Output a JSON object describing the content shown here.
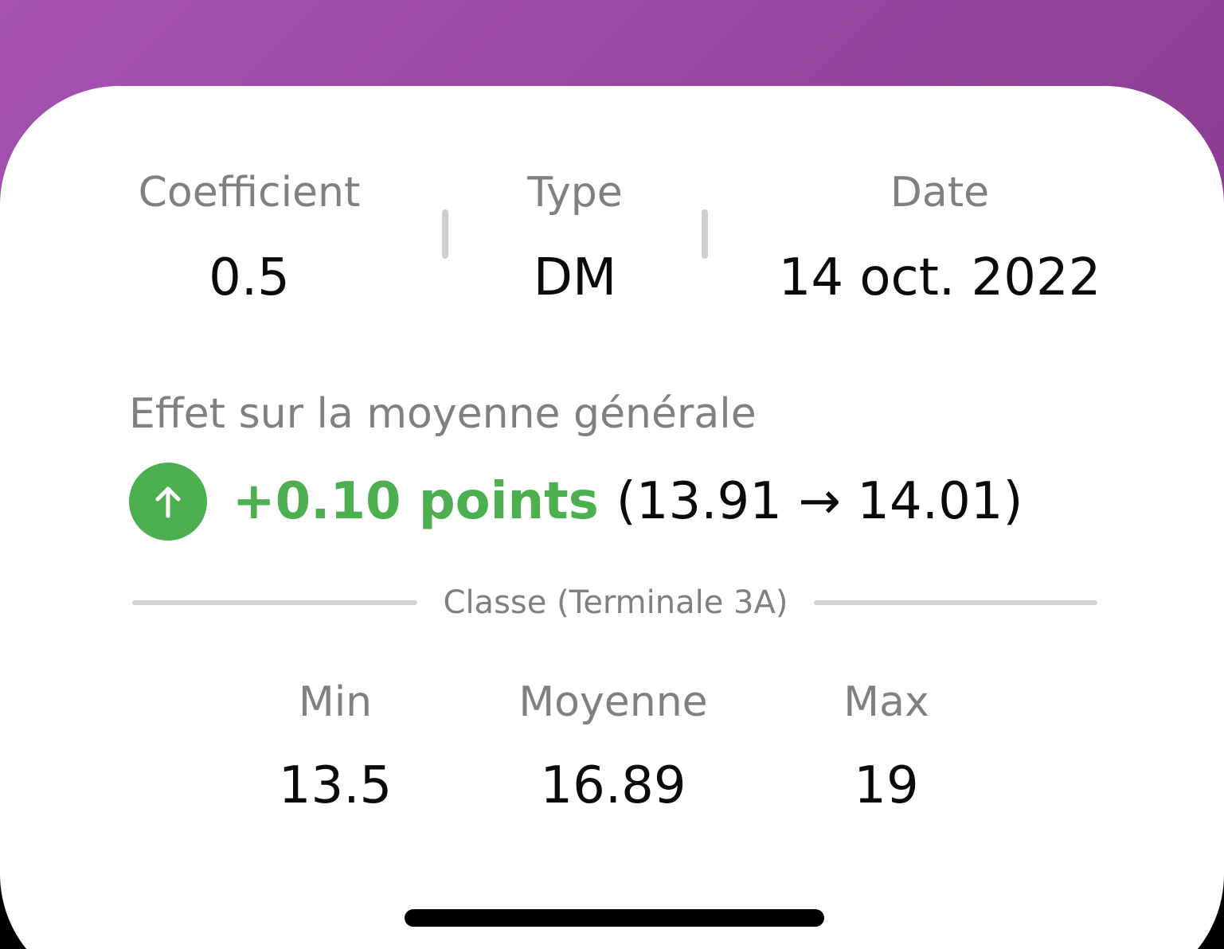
{
  "info": {
    "coefficient_label": "Coefficient",
    "coefficient_value": "0.5",
    "type_label": "Type",
    "type_value": "DM",
    "date_label": "Date",
    "date_value": "14 oct. 2022"
  },
  "effect": {
    "title": "Effet sur la moyenne générale",
    "icon": "arrow-up-icon",
    "delta": "+0.10 points",
    "range": "(13.91 → 14.01)",
    "color": "#4caf50"
  },
  "class": {
    "label": "Classe (Terminale 3A)",
    "min_label": "Min",
    "min_value": "13.5",
    "avg_label": "Moyenne",
    "avg_value": "16.89",
    "max_label": "Max",
    "max_value": "19"
  },
  "colors": {
    "header_gradient_start": "#a552b1",
    "header_gradient_end": "#8b3d93",
    "label_gray": "#808080",
    "positive_green": "#4caf50"
  }
}
